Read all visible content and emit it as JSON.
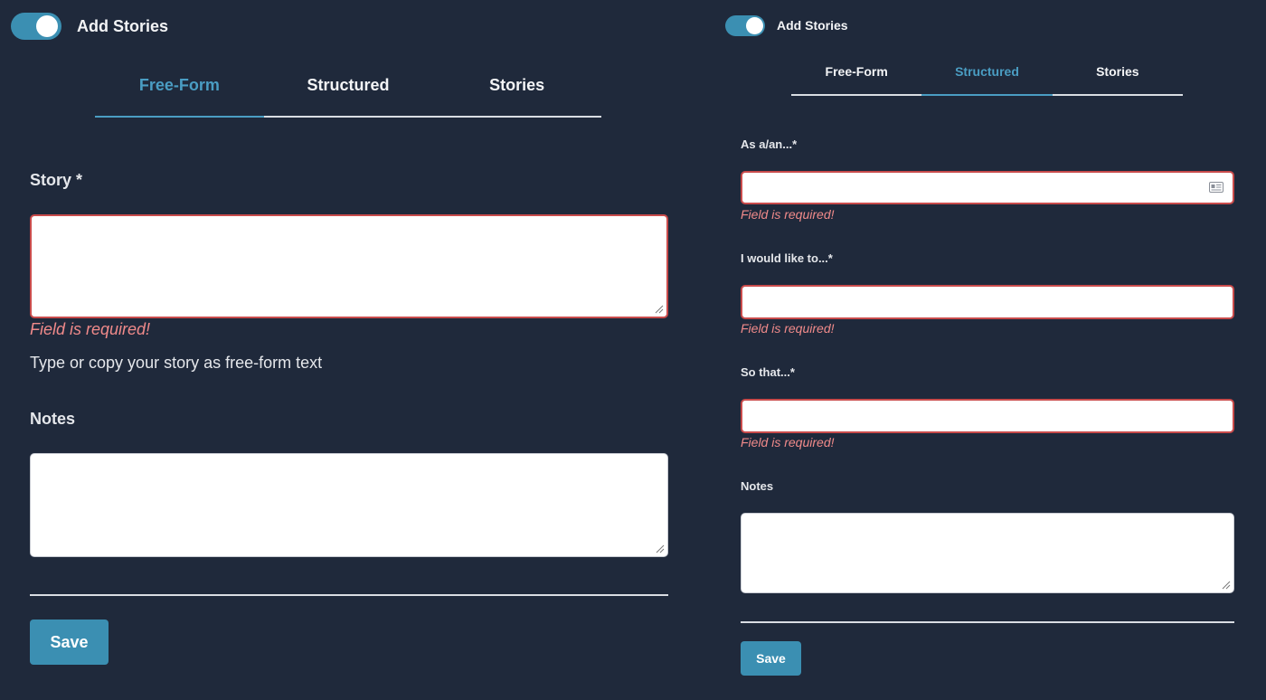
{
  "left": {
    "toggle": {
      "label": "Add Stories",
      "on": true
    },
    "tabs": [
      {
        "label": "Free-Form",
        "active": true
      },
      {
        "label": "Structured",
        "active": false
      },
      {
        "label": "Stories",
        "active": false
      }
    ],
    "story": {
      "label": "Story *",
      "value": "",
      "error": "Field is required!",
      "help": "Type or copy your story as free-form text"
    },
    "notes": {
      "label": "Notes",
      "value": ""
    },
    "save_label": "Save"
  },
  "right": {
    "toggle": {
      "label": "Add Stories",
      "on": true
    },
    "tabs": [
      {
        "label": "Free-Form",
        "active": false
      },
      {
        "label": "Structured",
        "active": true
      },
      {
        "label": "Stories",
        "active": false
      }
    ],
    "as_a": {
      "label": "As a/an...*",
      "value": "",
      "error": "Field is required!",
      "icon": "contact-card-icon"
    },
    "would_like": {
      "label": "I would like to...*",
      "value": "",
      "error": "Field is required!"
    },
    "so_that": {
      "label": "So that...*",
      "value": "",
      "error": "Field is required!"
    },
    "notes": {
      "label": "Notes",
      "value": ""
    },
    "save_label": "Save"
  },
  "colors": {
    "background": "#1f293b",
    "accent": "#3b8fb2",
    "active_tab": "#4a9dc3",
    "error": "#f08a8a",
    "invalid_border": "#c94b4b"
  }
}
